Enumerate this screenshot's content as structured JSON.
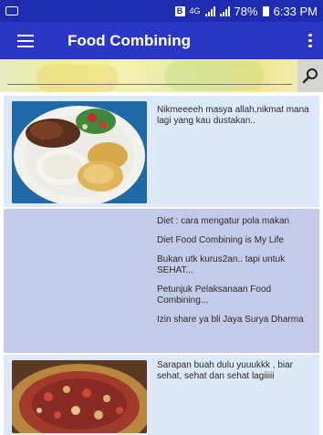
{
  "status_bar": {
    "battery": "78%",
    "time": "6:33 PM",
    "network": "4G"
  },
  "app_bar": {
    "title": "Food Combining"
  },
  "search": {
    "placeholder": "",
    "value": ""
  },
  "items": [
    {
      "image": "food-plate-photo",
      "captions": [
        "Nikmeeeeh masya allah,nikmat mana lagi yang kau dustakan.."
      ]
    },
    {
      "image": null,
      "captions": [
        "Diet : cara mengatur pola makan",
        "Diet Food Combining is My Life",
        "Bukan utk kurus2an.. tapi untuk SEHAT...",
        "Petunjuk Pelaksanaan Food Combining...",
        "Izin share ya bli Jaya Surya Dharma"
      ]
    },
    {
      "image": "fruit-dish-photo",
      "captions": [
        "Sarapan buah dulu yuuukkk , biar sehat, sehat dan sehat lagiiiii"
      ]
    }
  ]
}
